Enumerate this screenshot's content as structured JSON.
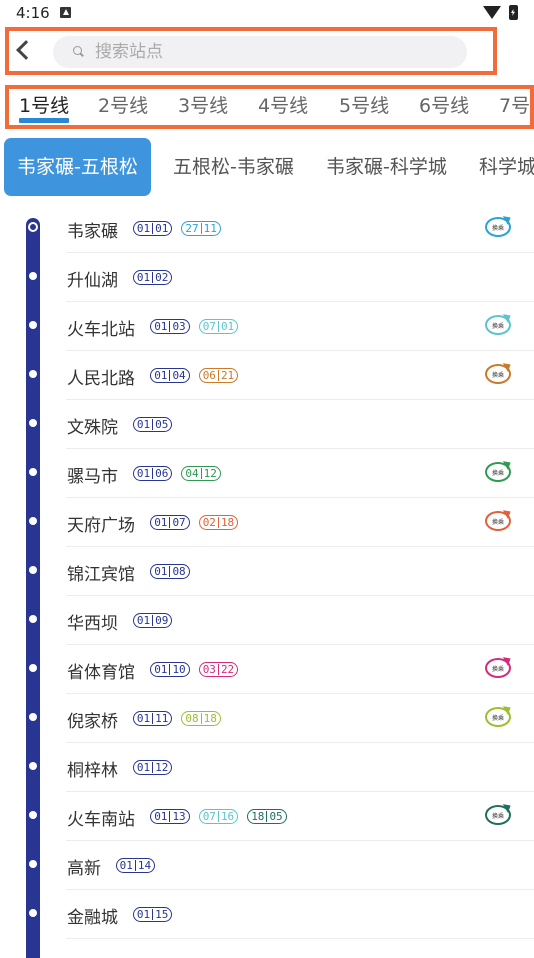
{
  "status": {
    "time": "4:16"
  },
  "search": {
    "placeholder": "搜索站点",
    "value": ""
  },
  "line_tabs": [
    "1号线",
    "2号线",
    "3号线",
    "4号线",
    "5号线",
    "6号线",
    "7号"
  ],
  "active_line": "1号线",
  "direction_tabs": [
    "韦家碾-五根松",
    "五根松-韦家碾",
    "韦家碾-科学城",
    "科学城"
  ],
  "line_color": "#283592",
  "stations": [
    {
      "name": "韦家碾",
      "codes": [
        {
          "a": "01",
          "b": "01",
          "color": "#283592"
        },
        {
          "a": "27",
          "b": "11",
          "color": "#2aa3d6"
        }
      ],
      "transfer": true,
      "transfer_color": "#2aa3d6"
    },
    {
      "name": "升仙湖",
      "codes": [
        {
          "a": "01",
          "b": "02",
          "color": "#283592"
        }
      ],
      "transfer": false
    },
    {
      "name": "火车北站",
      "codes": [
        {
          "a": "01",
          "b": "03",
          "color": "#283592"
        },
        {
          "a": "07",
          "b": "01",
          "color": "#5bc4cf"
        }
      ],
      "transfer": true,
      "transfer_color": "#5bc4cf"
    },
    {
      "name": "人民北路",
      "codes": [
        {
          "a": "01",
          "b": "04",
          "color": "#283592"
        },
        {
          "a": "06",
          "b": "21",
          "color": "#c97a2a"
        }
      ],
      "transfer": true,
      "transfer_color": "#c97a2a"
    },
    {
      "name": "文殊院",
      "codes": [
        {
          "a": "01",
          "b": "05",
          "color": "#283592"
        }
      ],
      "transfer": false
    },
    {
      "name": "骡马市",
      "codes": [
        {
          "a": "01",
          "b": "06",
          "color": "#283592"
        },
        {
          "a": "04",
          "b": "12",
          "color": "#2e9a52"
        }
      ],
      "transfer": true,
      "transfer_color": "#2e9a52"
    },
    {
      "name": "天府广场",
      "codes": [
        {
          "a": "01",
          "b": "07",
          "color": "#283592"
        },
        {
          "a": "02",
          "b": "18",
          "color": "#e0623a"
        }
      ],
      "transfer": true,
      "transfer_color": "#e0623a"
    },
    {
      "name": "锦江宾馆",
      "codes": [
        {
          "a": "01",
          "b": "08",
          "color": "#283592"
        }
      ],
      "transfer": false
    },
    {
      "name": "华西坝",
      "codes": [
        {
          "a": "01",
          "b": "09",
          "color": "#283592"
        }
      ],
      "transfer": false
    },
    {
      "name": "省体育馆",
      "codes": [
        {
          "a": "01",
          "b": "10",
          "color": "#283592"
        },
        {
          "a": "03",
          "b": "22",
          "color": "#d62a7a"
        }
      ],
      "transfer": true,
      "transfer_color": "#d62a7a"
    },
    {
      "name": "倪家桥",
      "codes": [
        {
          "a": "01",
          "b": "11",
          "color": "#283592"
        },
        {
          "a": "08",
          "b": "18",
          "color": "#9bbf2e"
        }
      ],
      "transfer": true,
      "transfer_color": "#9bbf2e"
    },
    {
      "name": "桐梓林",
      "codes": [
        {
          "a": "01",
          "b": "12",
          "color": "#283592"
        }
      ],
      "transfer": false
    },
    {
      "name": "火车南站",
      "codes": [
        {
          "a": "01",
          "b": "13",
          "color": "#283592"
        },
        {
          "a": "07",
          "b": "16",
          "color": "#5bc4cf"
        },
        {
          "a": "18",
          "b": "05",
          "color": "#1f6f5e"
        }
      ],
      "transfer": true,
      "transfer_color": "#1f6f5e"
    },
    {
      "name": "高新",
      "codes": [
        {
          "a": "01",
          "b": "14",
          "color": "#283592"
        }
      ],
      "transfer": false
    },
    {
      "name": "金融城",
      "codes": [
        {
          "a": "01",
          "b": "15",
          "color": "#283592"
        }
      ],
      "transfer": false
    }
  ],
  "transfer_label": "换乘"
}
